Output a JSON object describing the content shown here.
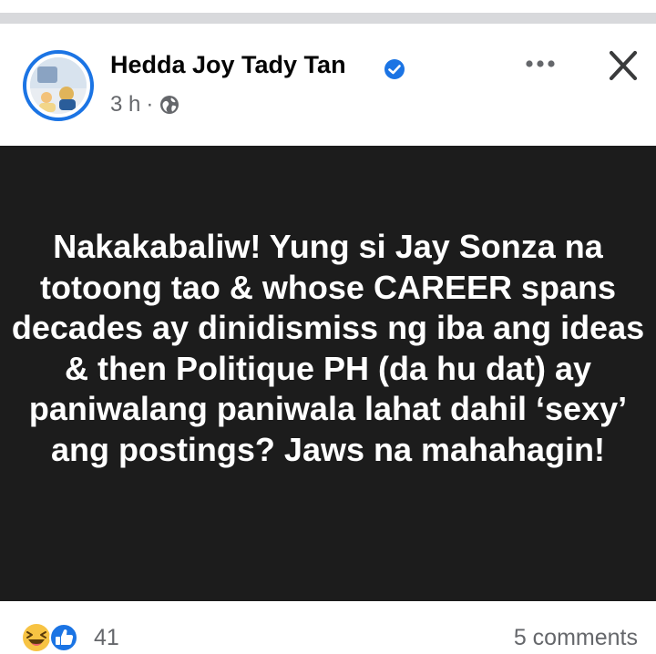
{
  "post": {
    "author": "Hedda Joy Tady Tan",
    "time": "3 h",
    "separator": "·",
    "body": "Nakakabaliw! Yung si Jay Sonza na totoong tao & whose CAREER spans decades ay dinidismiss ng iba ang ideas & then Politique PH (da hu dat) ay paniwalang paniwala lahat dahil ‘sexy’ ang postings? Jaws na mahahagin!",
    "reaction_count": "41",
    "comments": "5 comments",
    "icons": {
      "verified": "verified-badge-icon",
      "privacy": "globe-icon",
      "more": "more-options-icon",
      "close": "close-icon",
      "reactions": [
        "haha-icon",
        "like-icon"
      ]
    },
    "colors": {
      "accent": "#1b74e4",
      "post_bg": "#1c1c1c",
      "text": "#050505",
      "muted": "#65676b"
    }
  }
}
